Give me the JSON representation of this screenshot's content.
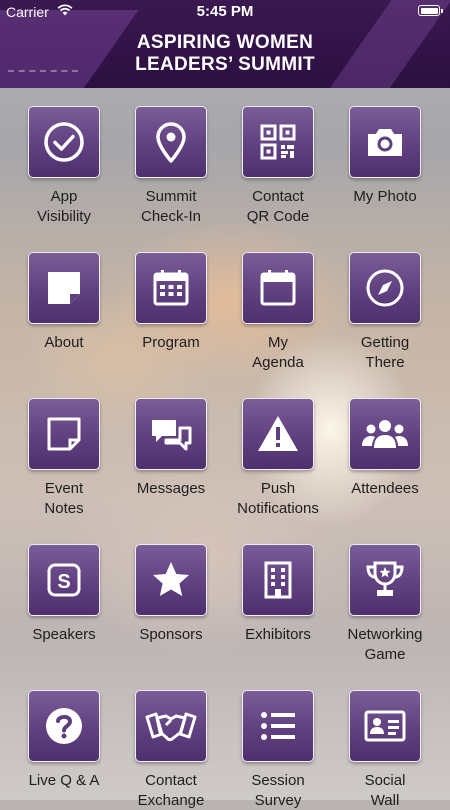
{
  "status_bar": {
    "carrier": "Carrier",
    "time": "5:45 PM"
  },
  "header": {
    "title_line1": "ASPIRING WOMEN",
    "title_line2": "LEADERS’ SUMMIT"
  },
  "tiles": [
    {
      "label": "App\nVisibility",
      "icon": "check-circle-icon"
    },
    {
      "label": "Summit\nCheck-In",
      "icon": "map-pin-icon"
    },
    {
      "label": "Contact\nQR Code",
      "icon": "qr-code-icon"
    },
    {
      "label": "My Photo",
      "icon": "camera-icon"
    },
    {
      "label": "About",
      "icon": "note-page-icon"
    },
    {
      "label": "Program",
      "icon": "calendar-grid-icon"
    },
    {
      "label": "My\nAgenda",
      "icon": "calendar-icon"
    },
    {
      "label": "Getting\nThere",
      "icon": "compass-icon"
    },
    {
      "label": "Event\nNotes",
      "icon": "note-outline-icon"
    },
    {
      "label": "Messages",
      "icon": "chat-bubbles-icon"
    },
    {
      "label": "Push\nNotifications",
      "icon": "warning-icon"
    },
    {
      "label": "Attendees",
      "icon": "people-group-icon"
    },
    {
      "label": "Speakers",
      "icon": "speaker-badge-icon"
    },
    {
      "label": "Sponsors",
      "icon": "star-icon"
    },
    {
      "label": "Exhibitors",
      "icon": "building-icon"
    },
    {
      "label": "Networking\nGame",
      "icon": "trophy-icon"
    },
    {
      "label": "Live Q & A",
      "icon": "question-icon"
    },
    {
      "label": "Contact\nExchange",
      "icon": "handshake-icon"
    },
    {
      "label": "Session\nSurvey",
      "icon": "list-icon"
    },
    {
      "label": "Social\nWall",
      "icon": "id-card-icon"
    }
  ]
}
